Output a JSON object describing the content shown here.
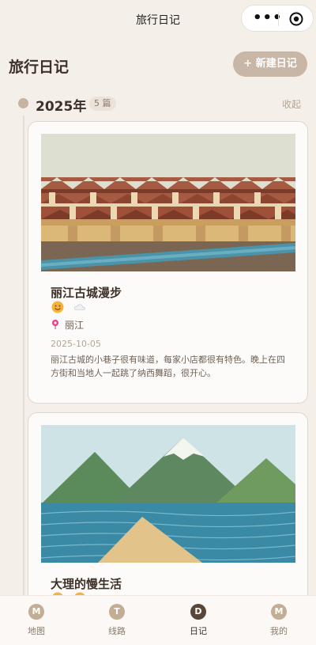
{
  "topbar": {
    "title": "旅行日记"
  },
  "header": {
    "title": "旅行日记",
    "new_button": "+ 新建日记"
  },
  "timeline": {
    "year": "2025年",
    "count": "5 篇",
    "collapse_label": "收起"
  },
  "entries": [
    {
      "title": "丽江古城漫步",
      "moods": [
        "smile-icon",
        "cloud-icon"
      ],
      "location": "丽江",
      "date": "2025-10-05",
      "excerpt": "丽江古城的小巷子很有味道，每家小店都很有特色。晚上在四方街和当地人一起跳了纳西舞蹈，很开心。"
    },
    {
      "title": "大理的慢生活",
      "moods": [
        "smile-icon",
        "smile-icon"
      ]
    }
  ],
  "tabs": [
    {
      "badge": "M",
      "label": "地图"
    },
    {
      "badge": "T",
      "label": "线路"
    },
    {
      "badge": "D",
      "label": "日记"
    },
    {
      "badge": "M",
      "label": "我的"
    }
  ],
  "colors": {
    "accent": "#c8b7a6",
    "active_tab": "#5a4638",
    "background": "#f4efe9"
  }
}
